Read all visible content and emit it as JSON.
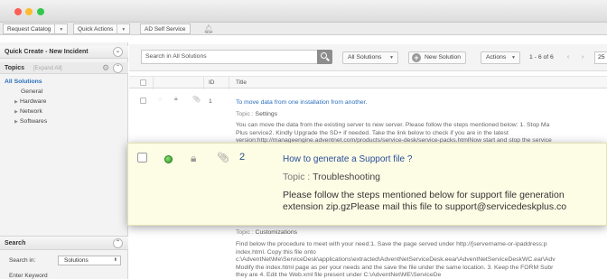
{
  "toolbar": {
    "request_catalog": "Request Catalog",
    "quick_actions": "Quick Actions",
    "ad_self_service": "AD Self Service"
  },
  "left_panel": {
    "quick_create": "Quick Create - New Incident",
    "topics": "Topics",
    "expand_all": "[Expand All]",
    "tree": {
      "root": "All Solutions",
      "items": [
        "General",
        "Hardware",
        "Network",
        "Softwares"
      ]
    },
    "search": {
      "title": "Search",
      "search_in_label": "Search in:",
      "search_in_value": "Solutions",
      "enter_keyword": "Enter Keyword"
    }
  },
  "main": {
    "search_placeholder": "Search in All Solutions",
    "filter_value": "All Solutions",
    "new_solution": "New Solution",
    "actions": "Actions",
    "pager": "1 - 6 of 6",
    "per_page": "25",
    "columns": {
      "id": "ID",
      "title": "Title"
    },
    "rows": [
      {
        "id": "1",
        "title": "To move data from one installation from another.",
        "topic_label": "Topic :",
        "topic": "Settings",
        "desc_lines": [
          "You can move the data from the existing server to new server. Please follow the steps mentioned below: 1. Stop Ma",
          "Plus service2. Kindly Upgrade the SD+ if needed. Take the link below to check if you are in the latest",
          "version:http://manageengine.adventnet.com/products/service-desk/service-packs.htmlNow start and stop the service"
        ]
      },
      {
        "topic_label": "Topic :",
        "topic": "Customizations",
        "desc_lines": [
          "Find below the procedure to meet with your need:1. Save the page served under http://[servername-or-ipaddress:p",
          "index.html. Copy this file onto",
          "c:\\AdventNet\\Me\\ServiceDesk\\applications\\extracted\\AdventNetServiceDesk.eear\\AdventNetServiceDeskWC.ear\\Adv",
          "Modify the index.html page as per your needs and the save the file under the same location. 3. Keep the FORM Subr",
          "they are 4. Edit the Web.xml file present under C:\\AdventNet\\ME\\ServiceDe"
        ]
      }
    ]
  },
  "popup": {
    "id": "2",
    "title": "How to generate a Support file ?",
    "topic_label": "Topic :",
    "topic": "Troubleshooting",
    "desc_line1": "Please follow the steps mentioned below for support file generation",
    "desc_line2": "extension zip.gzPlease mail this file to support@servicedeskplus.co"
  }
}
